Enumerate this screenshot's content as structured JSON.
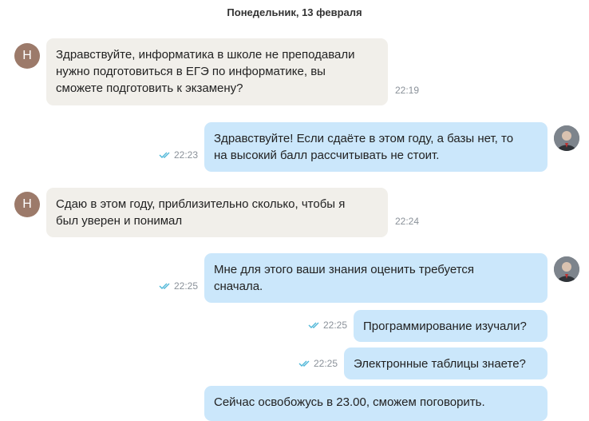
{
  "date_header": "Понедельник, 13 февраля",
  "colors": {
    "incoming_bubble": "#f1efea",
    "outgoing_bubble": "#cbe7fb",
    "check": "#4fb7d8"
  },
  "messages": [
    {
      "sender": "incoming",
      "avatar": "Н",
      "lines": [
        "Здравствуйте, информатика в школе не преподавали",
        "нужно подготовиться в ЕГЭ по информатике, вы",
        "сможете подготовить к экзамену?"
      ],
      "time": "22:19"
    },
    {
      "sender": "outgoing",
      "lines": [
        "Здравствуйте! Если сдаёте в этом году, а базы нет, то",
        "на высокий балл рассчитывать не стоит."
      ],
      "time": "22:23",
      "status_icon": "double-check-icon"
    },
    {
      "sender": "incoming",
      "avatar": "Н",
      "lines": [
        "Сдаю в этом году, приблизительно сколько, чтобы я",
        "был уверен и понимал"
      ],
      "time": "22:24"
    },
    {
      "sender": "outgoing",
      "lines": [
        "Мне для этого ваши знания оценить требуется",
        "сначала."
      ],
      "time": "22:25",
      "status_icon": "double-check-icon"
    },
    {
      "sender": "outgoing",
      "lines": [
        "Программирование изучали?"
      ],
      "time": "22:25",
      "status_icon": "double-check-icon"
    },
    {
      "sender": "outgoing",
      "lines": [
        "Электронные таблицы знаете?"
      ],
      "time": "22:25",
      "status_icon": "double-check-icon"
    },
    {
      "sender": "outgoing",
      "lines": [
        "Сейчас освобожусь в 23.00, сможем поговорить."
      ]
    }
  ]
}
